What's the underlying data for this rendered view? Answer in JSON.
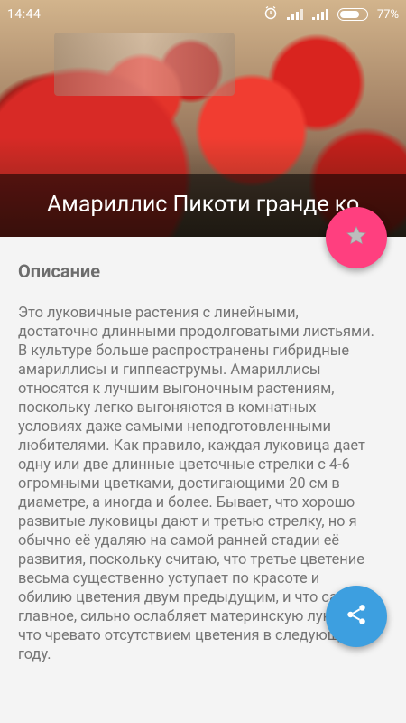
{
  "status_bar": {
    "time": "14:44",
    "battery_percent_text": "77%",
    "battery_level": 0.77,
    "icons": [
      "alarm-icon",
      "signal-icon",
      "signal-icon",
      "battery-icon"
    ]
  },
  "header": {
    "title": "Амариллис Пикоти гранде ко",
    "image": "amaryllis-flowers-photo"
  },
  "content": {
    "section_title": "Описание",
    "description": "Это луковичные растения с линейными, достаточно длинными продолговатыми листьями. В культуре больше распространены гибридные амариллисы и гиппеаструмы. Амариллисы относятся к лучшим выгоночным растениям, поскольку легко выгоняются в комнатных условиях даже самыми неподготовленными любителями. Как правило, каждая луковица дает одну или две длинные цветочные стрелки с 4-6 огромными цветками, достигающими 20 см в диаметре, а иногда и более. Бывает, что хорошо развитые луковицы дают и третью стрелку, но я обычно её удаляю на самой ранней стадии её развития, поскольку считаю, что третье цветение весьма существенно уступает по красоте и обилию цветения двум предыдущим, и что самое главное, сильно ослабляет материнскую луковицу, что чревато отсутствием цветения в следующем году."
  },
  "actions": {
    "favorite_icon": "star-icon",
    "share_icon": "share-icon",
    "favorite_color": "#FF3F7F",
    "share_color": "#3D9FE0"
  }
}
